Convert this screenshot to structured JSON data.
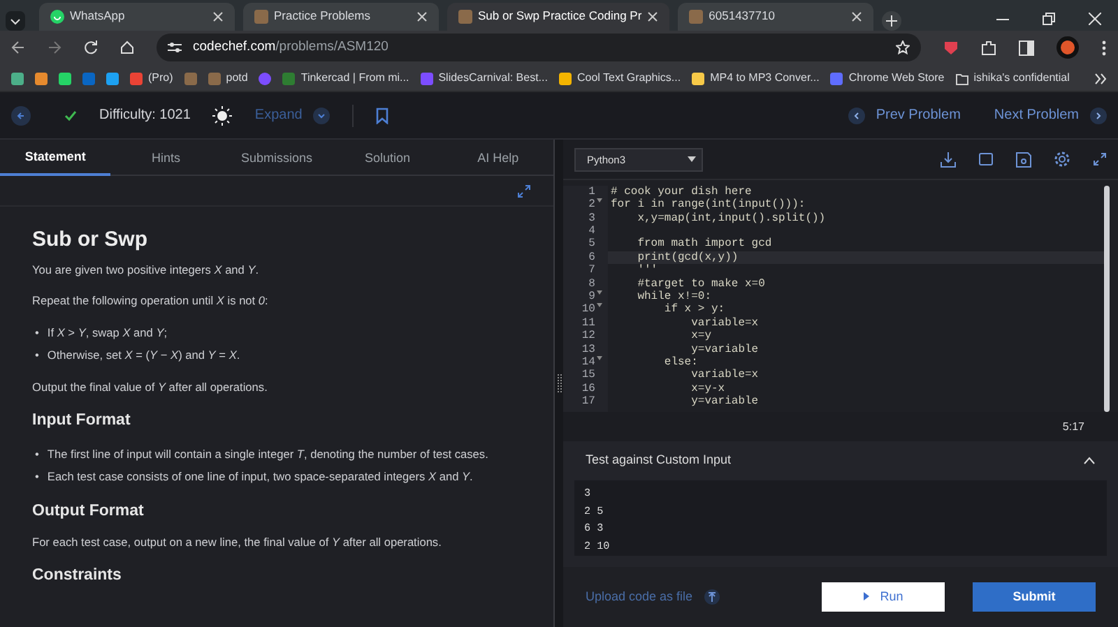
{
  "browser": {
    "tabs": [
      {
        "title": "WhatsApp",
        "kind": "whatsapp",
        "selected": false
      },
      {
        "title": "Practice Problems",
        "kind": "cc",
        "selected": false
      },
      {
        "title": "Sub or Swp Practice Coding Pr",
        "kind": "cc",
        "selected": true
      },
      {
        "title": "6051437710",
        "kind": "cc",
        "selected": false
      }
    ],
    "url": {
      "domain": "codechef.com",
      "path": "/problems/ASM120"
    },
    "bookmarks": [
      {
        "label": "(Pro)"
      },
      {
        "label": "potd"
      },
      {
        "label": "Tinkercad | From mi..."
      },
      {
        "label": "SlidesCarnival: Best..."
      },
      {
        "label": "Cool Text Graphics..."
      },
      {
        "label": "MP4 to MP3 Conver..."
      },
      {
        "label": "Chrome Web Store"
      },
      {
        "label": "ishika's confidential"
      }
    ]
  },
  "header": {
    "solved": true,
    "difficulty": "Difficulty: 1021",
    "expand": "Expand",
    "prev": "Prev Problem",
    "next": "Next Problem"
  },
  "problem_tabs": [
    {
      "label": "Statement",
      "selected": true
    },
    {
      "label": "Hints",
      "selected": false
    },
    {
      "label": "Submissions",
      "selected": false
    },
    {
      "label": "Solution",
      "selected": false
    },
    {
      "label": "AI Help",
      "selected": false
    }
  ],
  "statement": {
    "title": "Sub or Swp",
    "blocks": [
      {
        "kind": "para",
        "text": "You are given two positive integers *X* and *Y*."
      },
      {
        "kind": "para",
        "text": "Repeat the following operation until *X* is not *0*:"
      },
      {
        "kind": "list",
        "marker": "•",
        "items": [
          "If *X* > *Y*, swap *X* and *Y*;",
          "Otherwise, set *X* = (*Y* − *X*) and *Y* = *X*."
        ]
      },
      {
        "kind": "para",
        "text": "Output the final value of *Y* after all operations."
      },
      {
        "kind": "heading",
        "text": "Input Format"
      },
      {
        "kind": "list",
        "marker": "•",
        "items": [
          "The first line of input will contain a single integer *T*, denoting the number of test cases.",
          "Each test case consists of one line of input, two space-separated integers *X* and *Y*."
        ]
      },
      {
        "kind": "heading",
        "text": "Output Format"
      },
      {
        "kind": "para",
        "text": "For each test case, output on a new line, the final value of *Y* after all operations."
      },
      {
        "kind": "heading",
        "text": "Constraints"
      }
    ]
  },
  "editor": {
    "language": "Python3",
    "cursor": "5:17",
    "lines": [
      {
        "number": "1",
        "text": "# cook your dish here",
        "foldable": false,
        "active": false
      },
      {
        "number": "2",
        "text": "for i in range(int(input())):",
        "foldable": true,
        "active": false
      },
      {
        "number": "3",
        "text": "    x,y=map(int,input().split())",
        "foldable": false,
        "active": false
      },
      {
        "number": "4",
        "foldable": false,
        "active": false
      },
      {
        "number": "5",
        "text": "    from math import gcd",
        "foldable": false,
        "active": false
      },
      {
        "number": "6",
        "text": "    print(gcd(x,y))",
        "foldable": false,
        "active": true
      },
      {
        "number": "7",
        "text": "    '''",
        "foldable": false,
        "active": false
      },
      {
        "number": "8",
        "text": "    #target to make x=0",
        "foldable": false,
        "active": false
      },
      {
        "number": "9",
        "text": "    while x!=0:",
        "foldable": true,
        "active": false
      },
      {
        "number": "10",
        "text": "        if x > y:",
        "foldable": true,
        "active": false
      },
      {
        "number": "11",
        "text": "            variable=x",
        "foldable": false,
        "active": false
      },
      {
        "number": "12",
        "text": "            x=y",
        "foldable": false,
        "active": false
      },
      {
        "number": "13",
        "text": "            y=variable",
        "foldable": false,
        "active": false
      },
      {
        "number": "14",
        "text": "        else:",
        "foldable": true,
        "active": false
      },
      {
        "number": "15",
        "text": "            variable=x",
        "foldable": false,
        "active": false
      },
      {
        "number": "16",
        "text": "            x=y-x",
        "foldable": false,
        "active": false
      },
      {
        "number": "17",
        "text": "            y=variable",
        "foldable": false,
        "active": false
      }
    ]
  },
  "custom_input": {
    "title": "Test against Custom Input",
    "expanded": true,
    "lines": [
      "3",
      "2 5",
      "6 3",
      "2 10"
    ]
  },
  "footer": {
    "upload": "Upload code as file",
    "run": "Run",
    "submit": "Submit"
  }
}
